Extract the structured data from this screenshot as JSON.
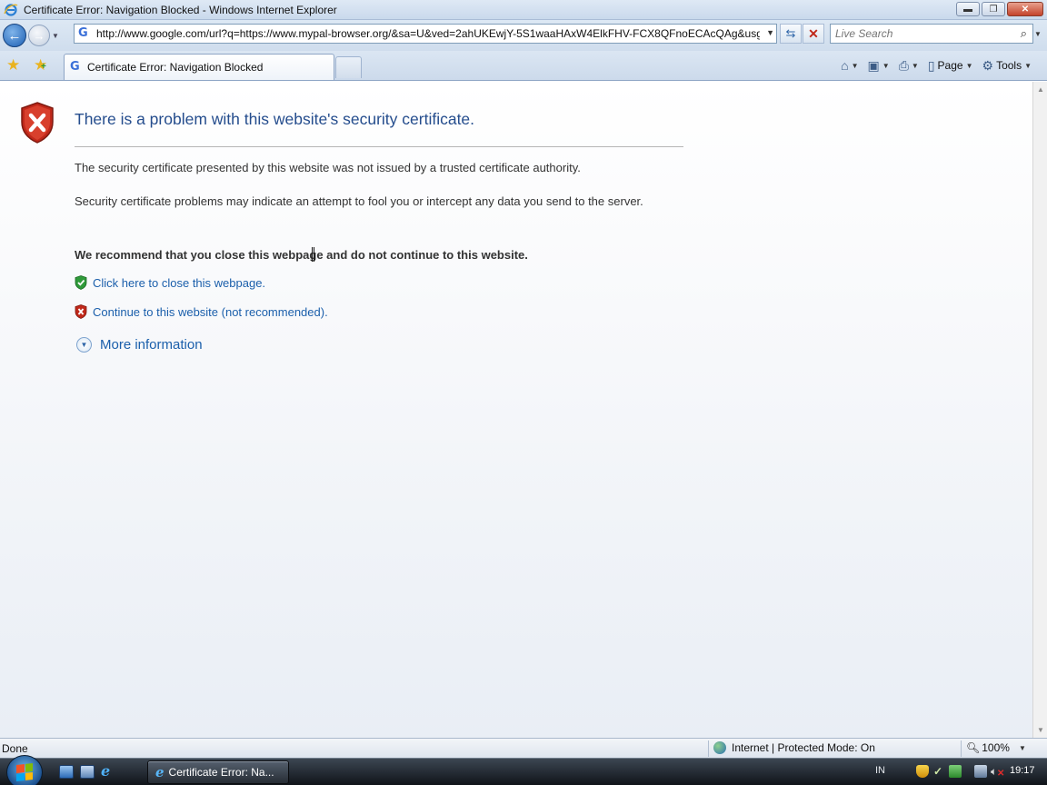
{
  "window": {
    "title": "Certificate Error: Navigation Blocked - Windows Internet Explorer",
    "controls": {
      "minimize": "▬",
      "maximize": "❐",
      "close": "✕"
    }
  },
  "addressbar": {
    "url": "http://www.google.com/url?q=https://www.mypal-browser.org/&sa=U&ved=2ahUKEwjY-5S1waaHAxW4ElkFHV-FCX8QFnoECAcQAg&usg=AOvVaw",
    "favicon": "G",
    "search_placeholder": "Live Search"
  },
  "tab": {
    "label": "Certificate Error: Navigation Blocked"
  },
  "commandbar": {
    "items": [
      {
        "label": "",
        "icon": "home-icon"
      },
      {
        "label": "",
        "icon": "feeds-icon"
      },
      {
        "label": "",
        "icon": "print-icon"
      },
      {
        "label": "Page",
        "icon": "page-icon"
      },
      {
        "label": "Tools",
        "icon": "gear-icon"
      }
    ]
  },
  "error_page": {
    "title": "There is a problem with this website's security certificate.",
    "paragraph1": "The security certificate presented by this website was not issued by a trusted certificate authority.",
    "paragraph2": "Security certificate problems may indicate an attempt to fool you or intercept any data you send to the server.",
    "recommendation": "We recommend that you close this webpage and do not continue to this website.",
    "close_link": "Click here to close this webpage.",
    "continue_link": "Continue to this website (not recommended).",
    "more_info": "More information"
  },
  "statusbar": {
    "status": "Done",
    "zone": "Internet | Protected Mode: On",
    "zoom": "100%"
  },
  "taskbar": {
    "task_label": "Certificate Error: Na...",
    "language": "IN",
    "time": "19:17"
  },
  "colors": {
    "title_blue": "#254d8d",
    "link_blue": "#1b5fab",
    "shield_red": "#c0281a",
    "shield_green": "#2f9a3a"
  }
}
